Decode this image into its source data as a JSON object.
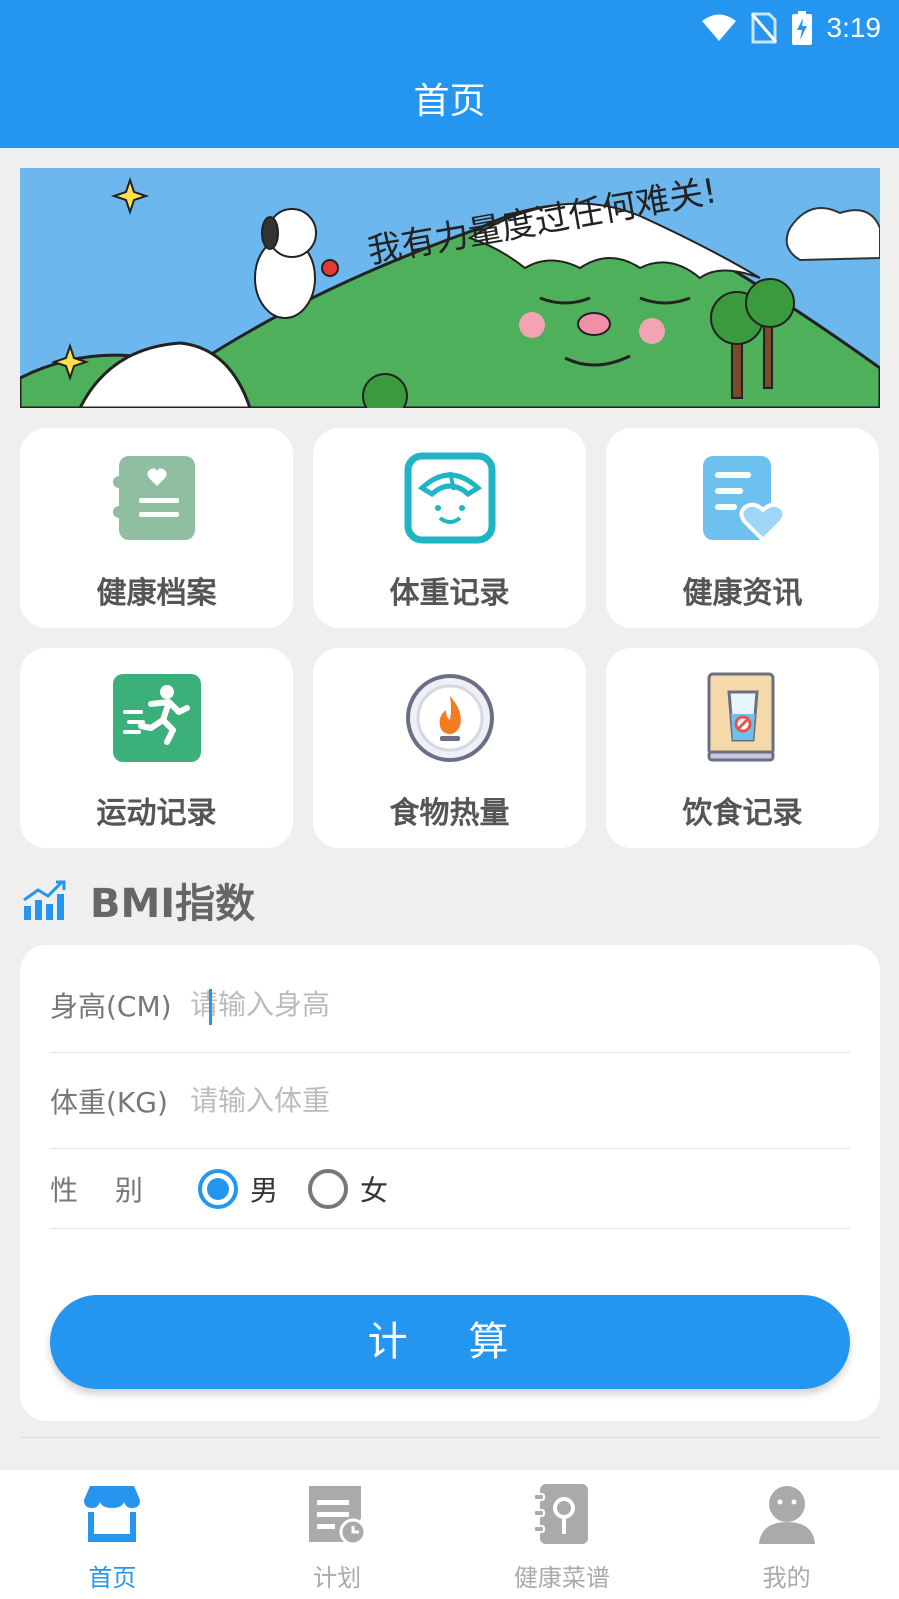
{
  "status": {
    "time": "3:19"
  },
  "header": {
    "title": "首页"
  },
  "banner": {
    "caption": "我有力量度过任何难关!"
  },
  "features": [
    {
      "label": "健康档案",
      "icon": "health-file-icon"
    },
    {
      "label": "体重记录",
      "icon": "weight-scale-icon"
    },
    {
      "label": "健康资讯",
      "icon": "health-news-icon"
    },
    {
      "label": "运动记录",
      "icon": "running-icon"
    },
    {
      "label": "食物热量",
      "icon": "calorie-flame-icon"
    },
    {
      "label": "饮食记录",
      "icon": "diet-book-icon"
    }
  ],
  "bmi": {
    "title": "BMI指数",
    "height_label": "身高(CM)",
    "height_placeholder": "请输入身高",
    "height_value": "",
    "weight_label": "体重(KG)",
    "weight_placeholder": "请输入体重",
    "weight_value": "",
    "gender_label": "性　 别",
    "male": "男",
    "female": "女",
    "selected_gender": "男",
    "calc_button": "计 算"
  },
  "nav": [
    {
      "label": "首页",
      "icon": "shop-home-icon",
      "active": true
    },
    {
      "label": "计划",
      "icon": "plan-icon",
      "active": false
    },
    {
      "label": "健康菜谱",
      "icon": "recipe-book-icon",
      "active": false
    },
    {
      "label": "我的",
      "icon": "profile-icon",
      "active": false
    }
  ],
  "colors": {
    "primary": "#2496ef",
    "background": "#efefef",
    "card": "#ffffff"
  }
}
